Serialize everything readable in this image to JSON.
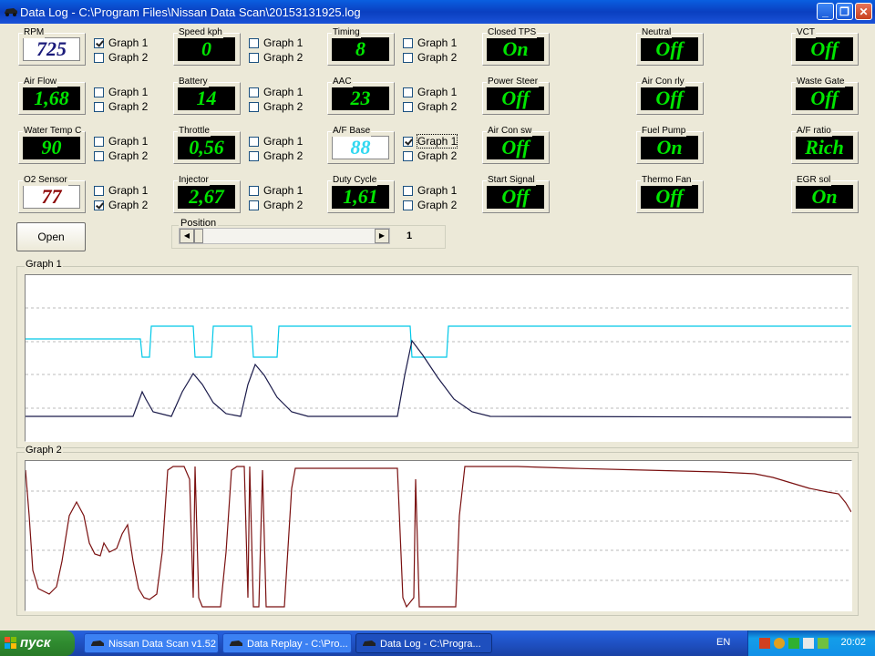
{
  "window": {
    "title": "Data Log - C:\\Program Files\\Nissan Data Scan\\20153131925.log",
    "minimize": "_",
    "restore": "❐",
    "close": "✕"
  },
  "gauges": [
    {
      "label": "RPM",
      "value": "725",
      "style": "white"
    },
    {
      "label": "Air Flow",
      "value": "1,68",
      "style": "green"
    },
    {
      "label": "Water Temp C",
      "value": "90",
      "style": "green"
    },
    {
      "label": "O2 Sensor",
      "value": "77",
      "style": "white-red"
    },
    {
      "label": "Speed kph",
      "value": "0",
      "style": "green"
    },
    {
      "label": "Battery",
      "value": "14",
      "style": "green"
    },
    {
      "label": "Throttle",
      "value": "0,56",
      "style": "green"
    },
    {
      "label": "Injector",
      "value": "2,67",
      "style": "green"
    },
    {
      "label": "Timing",
      "value": "8",
      "style": "green"
    },
    {
      "label": "AAC",
      "value": "23",
      "style": "green"
    },
    {
      "label": "A/F Base",
      "value": "88",
      "style": "cyan"
    },
    {
      "label": "Duty Cycle",
      "value": "1,61",
      "style": "green"
    },
    {
      "label": "Closed TPS",
      "value": "On",
      "style": "green"
    },
    {
      "label": "Power Steer",
      "value": "Off",
      "style": "green"
    },
    {
      "label": "Air Con sw",
      "value": "Off",
      "style": "green"
    },
    {
      "label": "Start Signal",
      "value": "Off",
      "style": "green"
    },
    {
      "label": "Neutral",
      "value": "Off",
      "style": "green"
    },
    {
      "label": "Air Con rly",
      "value": "Off",
      "style": "green"
    },
    {
      "label": "Fuel Pump",
      "value": "On",
      "style": "green"
    },
    {
      "label": "Thermo Fan",
      "value": "Off",
      "style": "green"
    },
    {
      "label": "VCT",
      "value": "Off",
      "style": "green"
    },
    {
      "label": "Waste Gate",
      "value": "Off",
      "style": "green"
    },
    {
      "label": "A/F ratio",
      "value": "Rich",
      "style": "green"
    },
    {
      "label": "EGR sol",
      "value": "On",
      "style": "green"
    }
  ],
  "checkbox_labels": {
    "g1": "Graph 1",
    "g2": "Graph 2"
  },
  "checked": {
    "RPM": [
      true,
      false
    ],
    "Air Flow": [
      false,
      false
    ],
    "Water Temp C": [
      false,
      false
    ],
    "O2 Sensor": [
      false,
      true
    ],
    "Speed kph": [
      false,
      false
    ],
    "Battery": [
      false,
      false
    ],
    "Throttle": [
      false,
      false
    ],
    "Injector": [
      false,
      false
    ],
    "Timing": [
      false,
      false
    ],
    "AAC": [
      false,
      false
    ],
    "A/F Base": [
      true,
      false
    ],
    "Duty Cycle": [
      false,
      false
    ]
  },
  "open_button": "Open",
  "position": {
    "label": "Position",
    "value": "1",
    "left_arrow": "◀",
    "right_arrow": "▶"
  },
  "graph1": {
    "label": "Graph 1",
    "series": [
      {
        "color": "#00c8e8",
        "kind": "rpm-like"
      },
      {
        "color": "#1a1a4a",
        "kind": "af-like"
      }
    ]
  },
  "graph2": {
    "label": "Graph 2",
    "series": [
      {
        "color": "#7a1010",
        "kind": "o2-like"
      }
    ]
  },
  "taskbar": {
    "start": "пуск",
    "tasks": [
      "Nissan Data Scan v1.52",
      "Data Replay - C:\\Pro...",
      "Data Log - C:\\Progra..."
    ],
    "lang": "EN",
    "clock": "20:02"
  },
  "colors": {
    "lcd_green": "#00e600",
    "lcd_bg": "#000000",
    "titlebar": "#0a4fd0",
    "taskbar": "#245edb"
  }
}
